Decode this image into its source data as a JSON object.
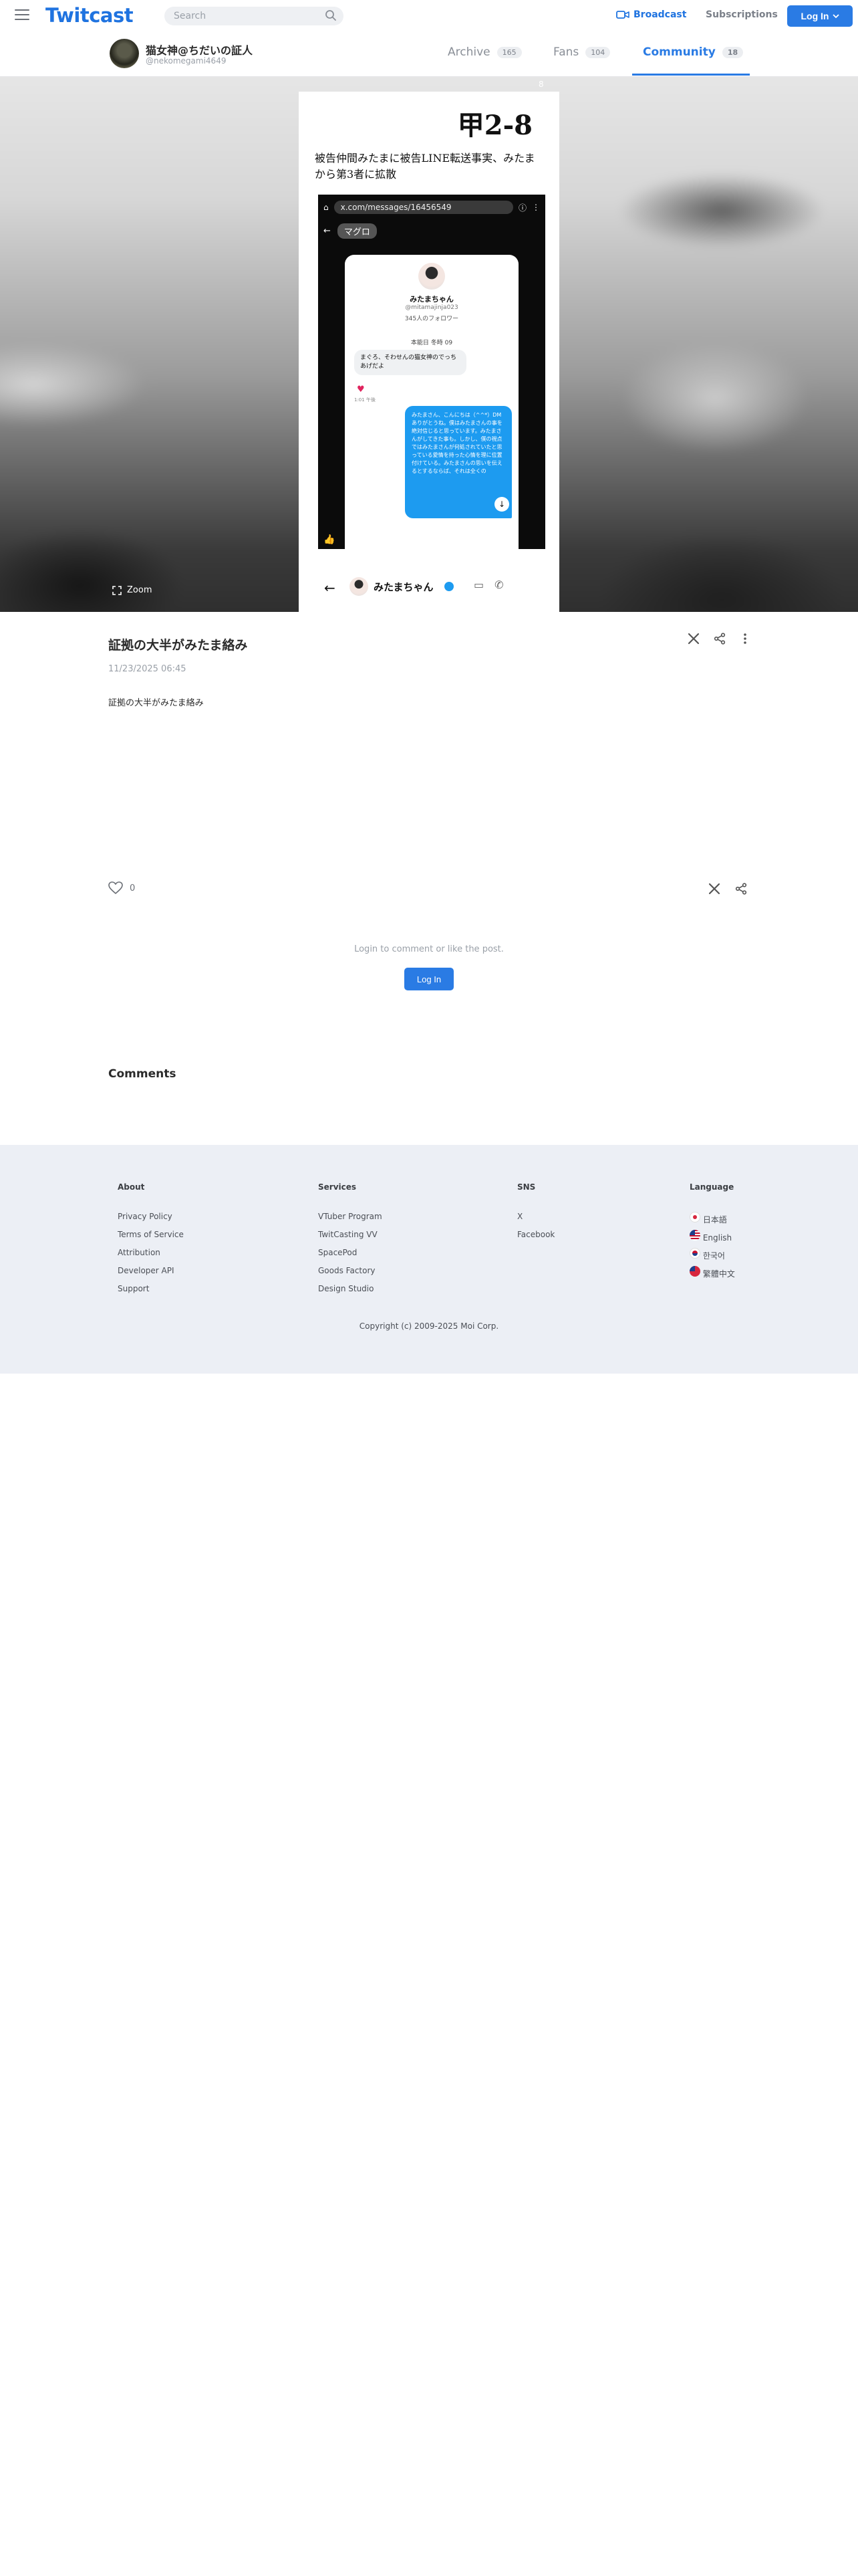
{
  "header": {
    "logo": "Twitcast",
    "search_placeholder": "Search",
    "broadcast_label": "Broadcast",
    "subscriptions_label": "Subscriptions",
    "login_label": "Log In"
  },
  "profile": {
    "name": "猫女神@ちだいの証人",
    "handle": "@nekomegami4649",
    "tabs": [
      {
        "label": "Archive",
        "count": "165"
      },
      {
        "label": "Fans",
        "count": "104"
      },
      {
        "label": "Community",
        "count": "18"
      }
    ],
    "active_tab": "Community"
  },
  "gallery": {
    "counter": "8",
    "zoom_label": "Zoom",
    "document": {
      "code": "甲2-8",
      "heading": "被告仲間みたまに被告LINE転送事実、みたまから第3者に拡散"
    },
    "screenshot": {
      "url": "x.com/messages/16456549",
      "chat_name": "マグロ",
      "profile_name": "みたまちゃん",
      "profile_handle": "@mitamajinja023",
      "followers": "345人のフォロワー",
      "date": "本能日 冬時 09",
      "left_message": "まぐろ、そわせんの猫女神のでっちあげだよ",
      "left_time": "1:01 午後",
      "right_message": "みたまさん、こんにちは（^^*）DMありがとうね。僕はみたまさんの事を絶対信じると思っています。みたまさんがしてきた事も。しかし、僕の視点ではみたまさんが何処されていたと思っている愛情を持った心情を理に位置付けている。みたまさんの思いを伝えるとするならば、それは全くの",
      "dm_name": "みたまちゃん"
    }
  },
  "post": {
    "title": "証拠の大半がみたま絡み",
    "date": "11/23/2025 06:45",
    "body": "証拠の大半がみたま絡み",
    "like_count": "0",
    "login_message": "Login to comment or like the post.",
    "login_button": "Log In",
    "comments_heading": "Comments"
  },
  "footer": {
    "columns": [
      {
        "title": "About",
        "links": [
          "Privacy Policy",
          "Terms of Service",
          "Attribution",
          "Developer API",
          "Support"
        ]
      },
      {
        "title": "Services",
        "links": [
          "VTuber Program",
          "TwitCasting VV",
          "SpacePod",
          "Goods Factory",
          "Design Studio"
        ]
      },
      {
        "title": "SNS",
        "links": [
          "X",
          "Facebook"
        ]
      }
    ],
    "language_title": "Language",
    "languages": [
      "日本語",
      "English",
      "한국어",
      "繁體中文"
    ],
    "copyright": "Copyright (c) 2009-2025 Moi Corp."
  },
  "colors": {
    "accent": "#2a7be4",
    "footer_bg": "#eceff5"
  }
}
